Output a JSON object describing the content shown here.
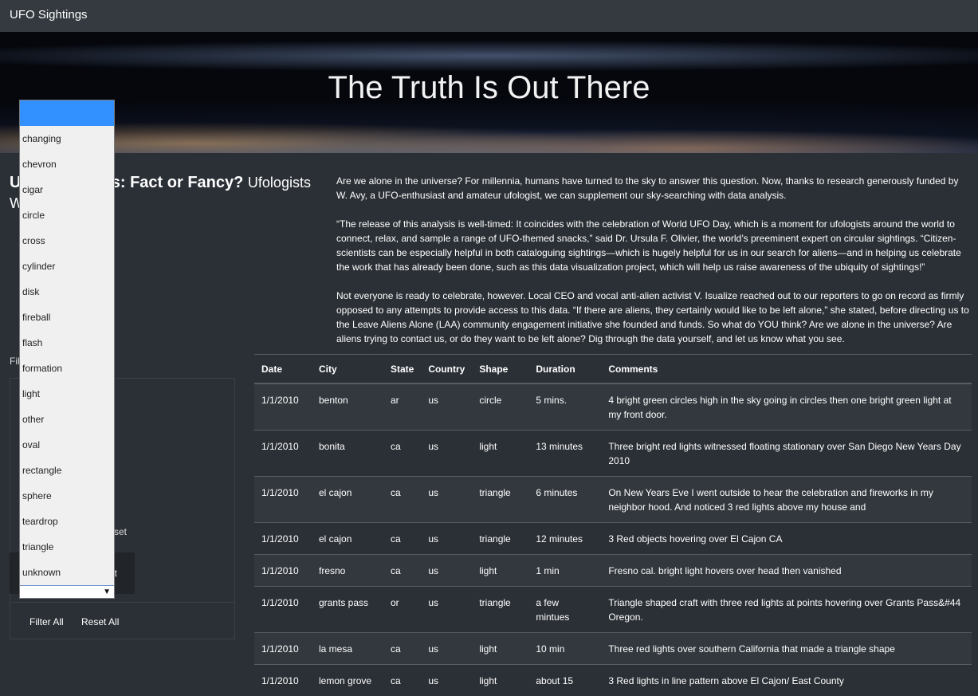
{
  "nav": {
    "brand": "UFO Sightings"
  },
  "hero": {
    "title": "The Truth Is Out There"
  },
  "left": {
    "heading_bold": "UFO Sightings: Fact or Fancy?",
    "heading_sub": "Ufologists Weigh In",
    "filter_label": "Filter Search",
    "reset_fragment": "set",
    "button_fragment": "t",
    "filter_all": "Filter All",
    "reset_all": "Reset All"
  },
  "dropdown": {
    "selected": "",
    "options": [
      "",
      "changing",
      "chevron",
      "cigar",
      "circle",
      "cross",
      "cylinder",
      "disk",
      "fireball",
      "flash",
      "formation",
      "light",
      "other",
      "oval",
      "rectangle",
      "sphere",
      "teardrop",
      "triangle",
      "unknown"
    ]
  },
  "article": {
    "p1": "Are we alone in the universe? For millennia, humans have turned to the sky to answer this question. Now, thanks to research generously funded by W. Avy, a UFO-enthusiast and amateur ufologist, we can supplement our sky-searching with data analysis.",
    "p2": "“The release of this analysis is well-timed: It coincides with the celebration of World UFO Day, which is a moment for ufologists around the world to connect, relax, and sample a range of UFO-themed snacks,” said Dr. Ursula F. Olivier, the world’s preeminent expert on circular sightings. “Citizen-scientists can be especially helpful in both cataloguing sightings—which is hugely helpful for us in our search for aliens—and in helping us celebrate the work that has already been done, such as this data visualization project, which will help us raise awareness of the ubiquity of sightings!”",
    "p3": "Not everyone is ready to celebrate, however. Local CEO and vocal anti-alien activist V. Isualize reached out to our reporters to go on record as firmly opposed to any attempts to provide access to this data. “If there are aliens, they certainly would like to be left alone,” she stated, before directing us to the Leave Aliens Alone (LAA) community engagement initiative she founded and funds. So what do YOU think? Are we alone in the universe? Are aliens trying to contact us, or do they want to be left alone? Dig through the data yourself, and let us know what you see."
  },
  "table": {
    "headers": [
      "Date",
      "City",
      "State",
      "Country",
      "Shape",
      "Duration",
      "Comments"
    ],
    "rows": [
      [
        "1/1/2010",
        "benton",
        "ar",
        "us",
        "circle",
        "5 mins.",
        "4 bright green circles high in the sky going in circles then one bright green light at my front door."
      ],
      [
        "1/1/2010",
        "bonita",
        "ca",
        "us",
        "light",
        "13 minutes",
        "Three bright red lights witnessed floating stationary over San Diego New Years Day 2010"
      ],
      [
        "1/1/2010",
        "el cajon",
        "ca",
        "us",
        "triangle",
        "6 minutes",
        "On New Years Eve I went outside to hear the celebration and fireworks in my neighbor hood. And noticed 3 red lights above my house and"
      ],
      [
        "1/1/2010",
        "el cajon",
        "ca",
        "us",
        "triangle",
        "12 minutes",
        "3 Red objects hovering over El Cajon CA"
      ],
      [
        "1/1/2010",
        "fresno",
        "ca",
        "us",
        "light",
        "1 min",
        "Fresno cal. bright light hovers over head then vanished"
      ],
      [
        "1/1/2010",
        "grants pass",
        "or",
        "us",
        "triangle",
        "a few mintues",
        "Triangle shaped craft with three red lights at points hovering over Grants Pass&#44 Oregon."
      ],
      [
        "1/1/2010",
        "la mesa",
        "ca",
        "us",
        "light",
        "10 min",
        "Three red lights over southern California that made a triangle shape"
      ],
      [
        "1/1/2010",
        "lemon grove",
        "ca",
        "us",
        "light",
        "about 15",
        "3 Red lights in line pattern above El Cajon/ East County"
      ]
    ]
  }
}
